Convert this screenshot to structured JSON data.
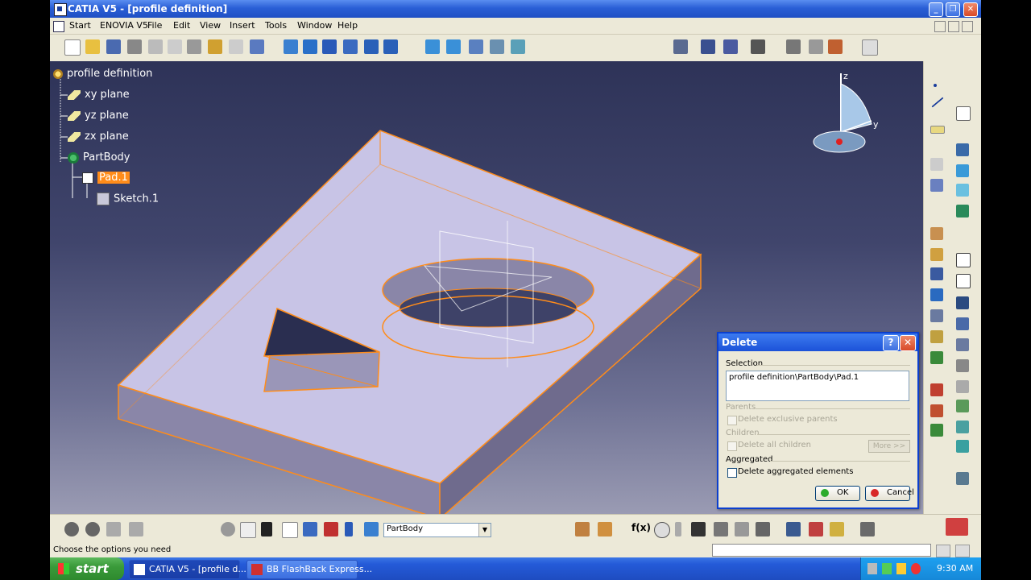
{
  "window": {
    "title": "CATIA V5 - [profile definition]"
  },
  "menu": [
    "Start",
    "ENOVIA V5",
    "File",
    "Edit",
    "View",
    "Insert",
    "Tools",
    "Window",
    "Help"
  ],
  "tree": {
    "root": "profile definition",
    "items": [
      "xy plane",
      "yz plane",
      "zx plane",
      "PartBody"
    ],
    "pad": "Pad.1",
    "sketch": "Sketch.1"
  },
  "compass": {
    "z": "z",
    "y": "y"
  },
  "dialog": {
    "title": "Delete",
    "help": "?",
    "close": "✕",
    "selection_label": "Selection",
    "selection_value": "profile definition\\PartBody\\Pad.1",
    "parents_label": "Parents",
    "delete_parents_label": "Delete exclusive parents",
    "children_label": "Children",
    "delete_children_label": "Delete all children",
    "more_label": "More >>",
    "aggregated_label": "Aggregated",
    "delete_aggregated_label": "Delete aggregated elements",
    "ok": "OK",
    "cancel": "Cancel"
  },
  "bottom": {
    "body_combo": "PartBody",
    "formula_label": "f(x)"
  },
  "status": {
    "text": "Choose the options you need"
  },
  "taskbar": {
    "start": "start",
    "tasks": [
      "CATIA V5 - [profile d...",
      "BB FlashBack Express..."
    ],
    "clock": "9:30 AM"
  },
  "colors": {
    "accent": "#ff8c1a",
    "viewport_top": "#2e3358",
    "viewport_bottom": "#9a9bb3",
    "part_face": "#c8c4e6"
  }
}
